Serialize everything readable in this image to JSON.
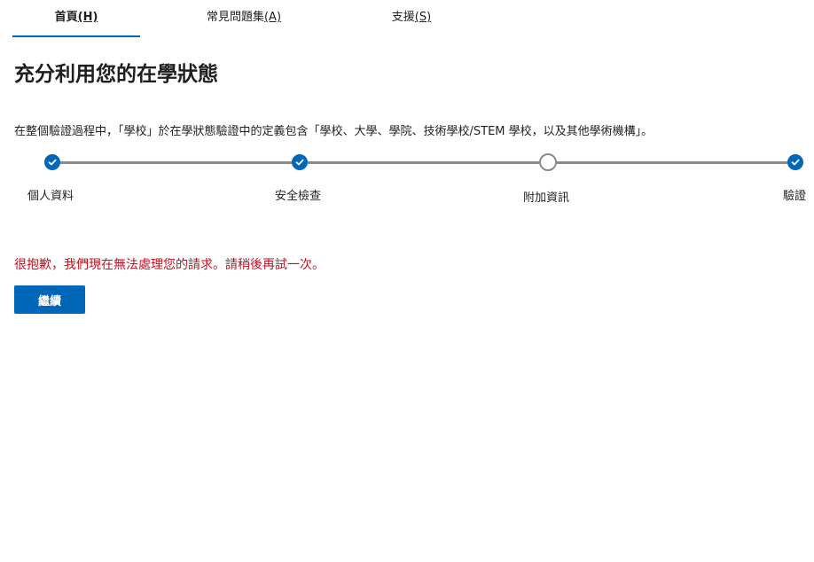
{
  "nav": {
    "tabs": [
      {
        "label": "首頁",
        "key_label": "(H)",
        "active": true
      },
      {
        "label": "常見問題集",
        "key_label": "(A)",
        "active": false
      },
      {
        "label": "支援",
        "key_label": "(S)",
        "active": false
      }
    ]
  },
  "page": {
    "title": "充分利用您的在學狀態",
    "description": "在整個驗證過程中，「學校」於在學狀態驗證中的定義包含「學校、大學、學院、技術學校/STEM 學校，以及其他學術機構」。"
  },
  "stepper": {
    "steps": [
      {
        "label": "個人資料",
        "status": "completed"
      },
      {
        "label": "安全檢查",
        "status": "completed"
      },
      {
        "label": "附加資訊",
        "status": "current"
      },
      {
        "label": "驗證",
        "status": "completed"
      }
    ]
  },
  "error": {
    "message": "很抱歉，我們現在無法處理您的請求。請稍後再試一次。"
  },
  "actions": {
    "continue_label": "繼續"
  },
  "colors": {
    "accent": "#0067b8",
    "error": "#c50f1f",
    "step_line": "#8a8a8a"
  },
  "icons": {
    "step_completed": "checkmark-icon",
    "step_current": "empty-circle-icon"
  }
}
